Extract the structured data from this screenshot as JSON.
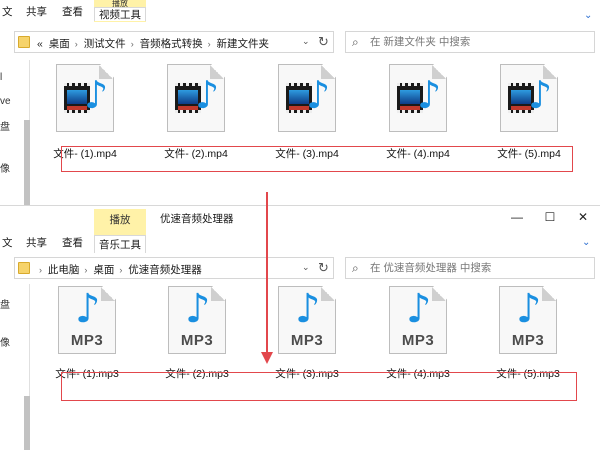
{
  "top_window": {
    "ribbon": {
      "tabs": [
        "共享",
        "查看"
      ],
      "context_tab_group": "播放",
      "context_tab": "视频工具"
    },
    "address": {
      "overflow": "«",
      "crumbs": [
        "桌面",
        "测试文件",
        "音频格式转换",
        "新建文件夹"
      ]
    },
    "search": {
      "placeholder": "在 新建文件夹 中搜索"
    },
    "left_pane": [
      "l",
      "ve",
      "盘",
      "像"
    ],
    "files": [
      {
        "name": "文件- (1).mp4",
        "type": "video"
      },
      {
        "name": "文件- (2).mp4",
        "type": "video"
      },
      {
        "name": "文件- (3).mp4",
        "type": "video"
      },
      {
        "name": "文件- (4).mp4",
        "type": "video"
      },
      {
        "name": "文件- (5).mp4",
        "type": "video"
      }
    ]
  },
  "bottom_window": {
    "title": "优速音频处理器",
    "ribbon": {
      "tabs": [
        "共享",
        "查看"
      ],
      "context_tab_group": "播放",
      "context_tab": "音乐工具"
    },
    "window_controls": [
      "—",
      "☐",
      "✕"
    ],
    "address": {
      "crumbs": [
        "此电脑",
        "桌面",
        "优速音频处理器"
      ]
    },
    "search": {
      "placeholder": "在 优速音频处理器 中搜索"
    },
    "left_pane": [
      "盘",
      "像"
    ],
    "files": [
      {
        "name": "文件- (1).mp3",
        "type": "audio",
        "icon_label": "MP3"
      },
      {
        "name": "文件- (2).mp3",
        "type": "audio",
        "icon_label": "MP3"
      },
      {
        "name": "文件- (3).mp3",
        "type": "audio",
        "icon_label": "MP3"
      },
      {
        "name": "文件- (4).mp3",
        "type": "audio",
        "icon_label": "MP3"
      },
      {
        "name": "文件- (5).mp3",
        "type": "audio",
        "icon_label": "MP3"
      }
    ]
  },
  "colors": {
    "annotation_red": "#e2474c",
    "context_tab_yellow": "#fff2a8",
    "note_blue": "#1a8fe0",
    "folder_yellow": "#f6d36b"
  },
  "icons": {
    "folder": "folder-icon",
    "search": "search-icon",
    "refresh": "refresh-icon",
    "video_file": "video-file-icon",
    "audio_file": "mp3-file-icon"
  }
}
